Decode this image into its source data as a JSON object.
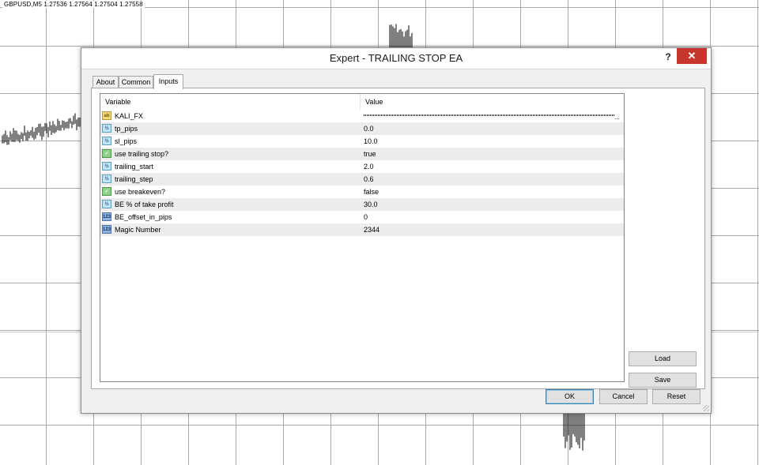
{
  "chart": {
    "quote": "GBPUSD,M5  1.27536 1.27564 1.27504 1.27558"
  },
  "dialog": {
    "title": "Expert - TRAILING STOP EA",
    "help_label": "?",
    "close_label": "✕",
    "tabs": [
      {
        "label": "About"
      },
      {
        "label": "Common"
      },
      {
        "label": "Inputs",
        "active": true
      }
    ],
    "grid": {
      "headers": {
        "variable": "Variable",
        "value": "Value"
      },
      "rows": [
        {
          "variable": "KALI_FX",
          "value": "",
          "type": "string",
          "icon": "string-icon",
          "icon_text": "ab"
        },
        {
          "variable": "tp_pips",
          "value": "0.0",
          "type": "double",
          "icon": "double-icon",
          "icon_text": "½"
        },
        {
          "variable": "sl_pips",
          "value": "10.0",
          "type": "double",
          "icon": "double-icon",
          "icon_text": "½"
        },
        {
          "variable": "use trailing stop?",
          "value": "true",
          "type": "bool",
          "icon": "bool-icon",
          "icon_text": "✓"
        },
        {
          "variable": "trailing_start",
          "value": "2.0",
          "type": "double",
          "icon": "double-icon",
          "icon_text": "½"
        },
        {
          "variable": "trailing_step",
          "value": "0.6",
          "type": "double",
          "icon": "double-icon",
          "icon_text": "½"
        },
        {
          "variable": "use breakeven?",
          "value": "false",
          "type": "bool",
          "icon": "bool-icon",
          "icon_text": "✓"
        },
        {
          "variable": "BE % of take profit",
          "value": "30.0",
          "type": "double",
          "icon": "double-icon",
          "icon_text": "½"
        },
        {
          "variable": "BE_offset_in_pips",
          "value": "0",
          "type": "int",
          "icon": "int-icon",
          "icon_text": "123"
        },
        {
          "variable": "Magic Number",
          "value": "2344",
          "type": "int",
          "icon": "int-icon",
          "icon_text": "123"
        }
      ],
      "ellipsis": "..."
    },
    "buttons": {
      "load": "Load",
      "save": "Save",
      "ok": "OK",
      "cancel": "Cancel",
      "reset": "Reset"
    }
  },
  "colors": {
    "close_button": "#c7372f",
    "row_alt": "#ececec",
    "dialog_bg": "#f0f0f0"
  }
}
